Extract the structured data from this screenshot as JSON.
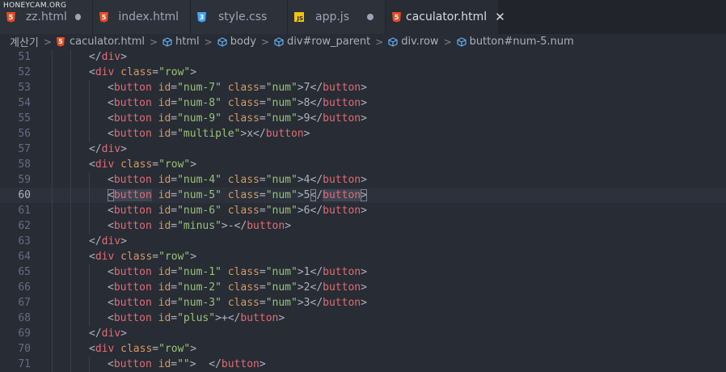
{
  "watermark": "HONEYCAM.ORG",
  "tabs": [
    {
      "label": "zz.html",
      "icon": "html5-icon",
      "modified": true,
      "active": false
    },
    {
      "label": "index.html",
      "icon": "html5-icon",
      "modified": false,
      "active": false
    },
    {
      "label": "style.css",
      "icon": "css3-icon",
      "modified": false,
      "active": false
    },
    {
      "label": "app.js",
      "icon": "js-icon",
      "modified": true,
      "active": false
    },
    {
      "label": "caculator.html",
      "icon": "html5-icon",
      "modified": false,
      "active": true
    }
  ],
  "close_glyph": "✕",
  "breadcrumb": {
    "items": [
      "계산기",
      "caculator.html",
      "html",
      "body",
      "div#row_parent",
      "div.row",
      "button#num-5.num"
    ],
    "separator": ">"
  },
  "editor": {
    "current_line": 60,
    "lines": [
      {
        "n": "51",
        "indent": 2,
        "tokens": [
          [
            "pn",
            "</"
          ],
          [
            "tg",
            "div"
          ],
          [
            "pn",
            ">"
          ]
        ]
      },
      {
        "n": "52",
        "indent": 2,
        "tokens": [
          [
            "pn",
            "<"
          ],
          [
            "tg",
            "div"
          ],
          [
            "at",
            " class"
          ],
          [
            "pn",
            "="
          ],
          [
            "st",
            "\"row\""
          ],
          [
            "pn",
            ">"
          ]
        ]
      },
      {
        "n": "53",
        "indent": 3,
        "tokens": [
          [
            "pn",
            "<"
          ],
          [
            "tg",
            "button"
          ],
          [
            "at",
            " id"
          ],
          [
            "pn",
            "="
          ],
          [
            "st",
            "\"num-7\""
          ],
          [
            "at",
            " class"
          ],
          [
            "pn",
            "="
          ],
          [
            "st",
            "\"num\""
          ],
          [
            "pn",
            ">7</"
          ],
          [
            "tg",
            "button"
          ],
          [
            "pn",
            ">"
          ]
        ]
      },
      {
        "n": "54",
        "indent": 3,
        "tokens": [
          [
            "pn",
            "<"
          ],
          [
            "tg",
            "button"
          ],
          [
            "at",
            " id"
          ],
          [
            "pn",
            "="
          ],
          [
            "st",
            "\"num-8\""
          ],
          [
            "at",
            " class"
          ],
          [
            "pn",
            "="
          ],
          [
            "st",
            "\"num\""
          ],
          [
            "pn",
            ">8</"
          ],
          [
            "tg",
            "button"
          ],
          [
            "pn",
            ">"
          ]
        ]
      },
      {
        "n": "55",
        "indent": 3,
        "tokens": [
          [
            "pn",
            "<"
          ],
          [
            "tg",
            "button"
          ],
          [
            "at",
            " id"
          ],
          [
            "pn",
            "="
          ],
          [
            "st",
            "\"num-9\""
          ],
          [
            "at",
            " class"
          ],
          [
            "pn",
            "="
          ],
          [
            "st",
            "\"num\""
          ],
          [
            "pn",
            ">9</"
          ],
          [
            "tg",
            "button"
          ],
          [
            "pn",
            ">"
          ]
        ]
      },
      {
        "n": "56",
        "indent": 3,
        "tokens": [
          [
            "pn",
            "<"
          ],
          [
            "tg",
            "button"
          ],
          [
            "at",
            " id"
          ],
          [
            "pn",
            "="
          ],
          [
            "st",
            "\"multiple\""
          ],
          [
            "pn",
            ">x</"
          ],
          [
            "tg",
            "button"
          ],
          [
            "pn",
            ">"
          ]
        ]
      },
      {
        "n": "57",
        "indent": 2,
        "tokens": [
          [
            "pn",
            "</"
          ],
          [
            "tg",
            "div"
          ],
          [
            "pn",
            ">"
          ]
        ]
      },
      {
        "n": "58",
        "indent": 2,
        "tokens": [
          [
            "pn",
            "<"
          ],
          [
            "tg",
            "div"
          ],
          [
            "at",
            " class"
          ],
          [
            "pn",
            "="
          ],
          [
            "st",
            "\"row\""
          ],
          [
            "pn",
            ">"
          ]
        ]
      },
      {
        "n": "59",
        "indent": 3,
        "tokens": [
          [
            "pn",
            "<"
          ],
          [
            "tg",
            "button"
          ],
          [
            "at",
            " id"
          ],
          [
            "pn",
            "="
          ],
          [
            "st",
            "\"num-4\""
          ],
          [
            "at",
            " class"
          ],
          [
            "pn",
            "="
          ],
          [
            "st",
            "\"num\""
          ],
          [
            "pn",
            ">4</"
          ],
          [
            "tg",
            "button"
          ],
          [
            "pn",
            ">"
          ]
        ]
      },
      {
        "n": "60",
        "indent": 3,
        "tokens": [
          [
            "pnm",
            "<"
          ],
          [
            "tgh",
            "button"
          ],
          [
            "at",
            " id"
          ],
          [
            "pn",
            "="
          ],
          [
            "st",
            "\"num-5\""
          ],
          [
            "at",
            " class"
          ],
          [
            "pn",
            "="
          ],
          [
            "st",
            "\"num\""
          ],
          [
            "pn",
            ">5"
          ],
          [
            "pnm",
            "<"
          ],
          [
            "pn",
            "/"
          ],
          [
            "tgh",
            "button"
          ],
          [
            "pnm",
            ">"
          ]
        ]
      },
      {
        "n": "61",
        "indent": 3,
        "tokens": [
          [
            "pn",
            "<"
          ],
          [
            "tg",
            "button"
          ],
          [
            "at",
            " id"
          ],
          [
            "pn",
            "="
          ],
          [
            "st",
            "\"num-6\""
          ],
          [
            "at",
            " class"
          ],
          [
            "pn",
            "="
          ],
          [
            "st",
            "\"num\""
          ],
          [
            "pn",
            ">6</"
          ],
          [
            "tg",
            "button"
          ],
          [
            "pn",
            ">"
          ]
        ]
      },
      {
        "n": "62",
        "indent": 3,
        "tokens": [
          [
            "pn",
            "<"
          ],
          [
            "tg",
            "button"
          ],
          [
            "at",
            " id"
          ],
          [
            "pn",
            "="
          ],
          [
            "st",
            "\"minus\""
          ],
          [
            "pn",
            ">-</"
          ],
          [
            "tg",
            "button"
          ],
          [
            "pn",
            ">"
          ]
        ]
      },
      {
        "n": "63",
        "indent": 2,
        "tokens": [
          [
            "pn",
            "</"
          ],
          [
            "tg",
            "div"
          ],
          [
            "pn",
            ">"
          ]
        ]
      },
      {
        "n": "64",
        "indent": 2,
        "tokens": [
          [
            "pn",
            "<"
          ],
          [
            "tg",
            "div"
          ],
          [
            "at",
            " class"
          ],
          [
            "pn",
            "="
          ],
          [
            "st",
            "\"row\""
          ],
          [
            "pn",
            ">"
          ]
        ]
      },
      {
        "n": "65",
        "indent": 3,
        "tokens": [
          [
            "pn",
            "<"
          ],
          [
            "tg",
            "button"
          ],
          [
            "at",
            " id"
          ],
          [
            "pn",
            "="
          ],
          [
            "st",
            "\"num-1\""
          ],
          [
            "at",
            " class"
          ],
          [
            "pn",
            "="
          ],
          [
            "st",
            "\"num\""
          ],
          [
            "pn",
            ">1</"
          ],
          [
            "tg",
            "button"
          ],
          [
            "pn",
            ">"
          ]
        ]
      },
      {
        "n": "66",
        "indent": 3,
        "tokens": [
          [
            "pn",
            "<"
          ],
          [
            "tg",
            "button"
          ],
          [
            "at",
            " id"
          ],
          [
            "pn",
            "="
          ],
          [
            "st",
            "\"num-2\""
          ],
          [
            "at",
            " class"
          ],
          [
            "pn",
            "="
          ],
          [
            "st",
            "\"num\""
          ],
          [
            "pn",
            ">2</"
          ],
          [
            "tg",
            "button"
          ],
          [
            "pn",
            ">"
          ]
        ]
      },
      {
        "n": "67",
        "indent": 3,
        "tokens": [
          [
            "pn",
            "<"
          ],
          [
            "tg",
            "button"
          ],
          [
            "at",
            " id"
          ],
          [
            "pn",
            "="
          ],
          [
            "st",
            "\"num-3\""
          ],
          [
            "at",
            " class"
          ],
          [
            "pn",
            "="
          ],
          [
            "st",
            "\"num\""
          ],
          [
            "pn",
            ">3</"
          ],
          [
            "tg",
            "button"
          ],
          [
            "pn",
            ">"
          ]
        ]
      },
      {
        "n": "68",
        "indent": 3,
        "tokens": [
          [
            "pn",
            "<"
          ],
          [
            "tg",
            "button"
          ],
          [
            "at",
            " id"
          ],
          [
            "pn",
            "="
          ],
          [
            "st",
            "\"plus\""
          ],
          [
            "pn",
            ">+</"
          ],
          [
            "tg",
            "button"
          ],
          [
            "pn",
            ">"
          ]
        ]
      },
      {
        "n": "69",
        "indent": 2,
        "tokens": [
          [
            "pn",
            "</"
          ],
          [
            "tg",
            "div"
          ],
          [
            "pn",
            ">"
          ]
        ]
      },
      {
        "n": "70",
        "indent": 2,
        "tokens": [
          [
            "pn",
            "<"
          ],
          [
            "tg",
            "div"
          ],
          [
            "at",
            " class"
          ],
          [
            "pn",
            "="
          ],
          [
            "st",
            "\"row\""
          ],
          [
            "pn",
            ">"
          ]
        ]
      },
      {
        "n": "71",
        "indent": 3,
        "tokens": [
          [
            "pn",
            "<"
          ],
          [
            "tg",
            "button"
          ],
          [
            "at",
            " id"
          ],
          [
            "pn",
            "="
          ],
          [
            "st",
            "\"\""
          ],
          [
            "pn",
            ">  </"
          ],
          [
            "tg",
            "button"
          ],
          [
            "pn",
            ">"
          ]
        ]
      }
    ]
  },
  "colors": {
    "background": "#282c34",
    "tag": "#e06c75",
    "attribute": "#d19a66",
    "string": "#98c379",
    "punctuation": "#abb2bf",
    "line_number": "#636d83"
  }
}
